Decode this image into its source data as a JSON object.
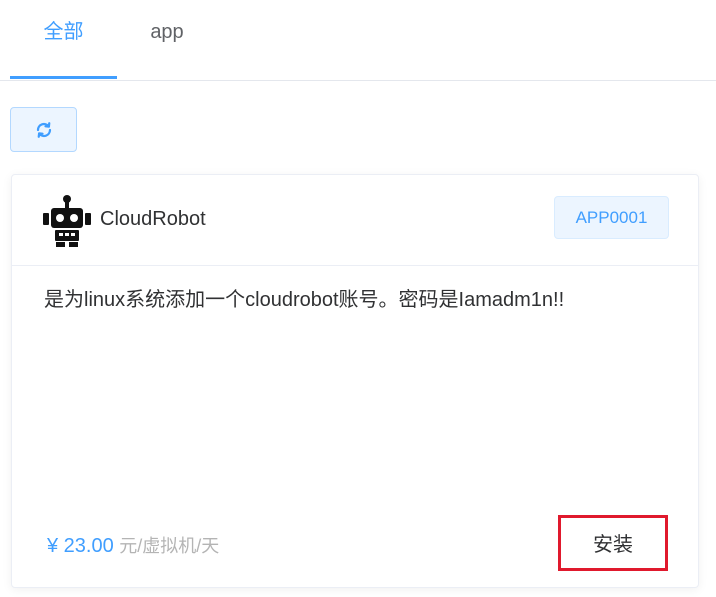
{
  "tabs": [
    {
      "label": "全部",
      "active": true
    },
    {
      "label": "app",
      "active": false
    }
  ],
  "toolbar": {
    "refresh_icon": "refresh-icon"
  },
  "card": {
    "icon": "robot-icon",
    "name": "CloudRobot",
    "code": "APP0001",
    "description": "是为linux系统添加一个cloudrobot账号。密码是Iamadm1n!!",
    "price": "¥ 23.00",
    "price_unit": "元/虚拟机/天",
    "install_label": "安装"
  },
  "colors": {
    "accent": "#409eff",
    "highlight_border": "#e0192d",
    "muted": "#b4b4b4"
  }
}
